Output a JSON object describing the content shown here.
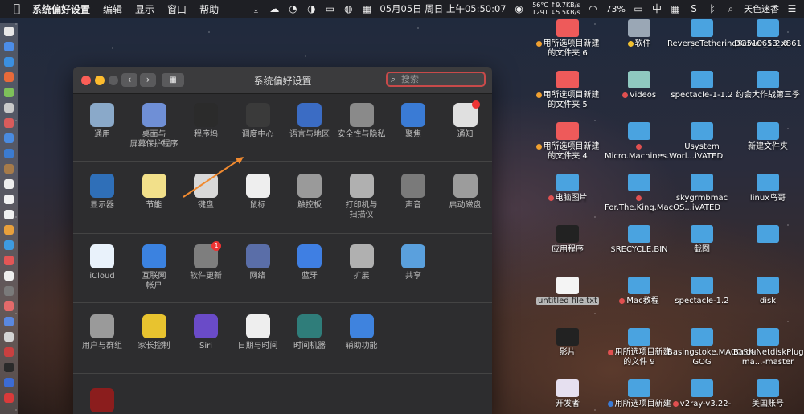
{
  "menubar": {
    "app_name": "系统偏好设置",
    "menus": [
      "编辑",
      "显示",
      "窗口",
      "帮助"
    ],
    "net_up": "56°C ↑9.7KB/s",
    "net_down": "1291 ↓5.5KB/s",
    "clock": "05月05日 周日 上午05:50:07",
    "battery": "73%",
    "input_method": "中",
    "user": "天色迷香"
  },
  "window": {
    "title": "系统偏好设置",
    "search_placeholder": "搜索"
  },
  "panes": {
    "row1": [
      {
        "label": "通用",
        "icon": "general-icon",
        "color": "#8aa9c9"
      },
      {
        "label": "桌面与\n屏幕保护程序",
        "icon": "desktop-icon",
        "color": "#6f8fd6"
      },
      {
        "label": "程序坞",
        "icon": "dock-icon",
        "color": "#2b2b2b"
      },
      {
        "label": "调度中心",
        "icon": "mission-control-icon",
        "color": "#3a3a3a"
      },
      {
        "label": "语言与地区",
        "icon": "language-flag-icon",
        "color": "#3b6cc4"
      },
      {
        "label": "安全性与隐私",
        "icon": "security-house-icon",
        "color": "#8a8a8a"
      },
      {
        "label": "聚焦",
        "icon": "spotlight-icon",
        "color": "#3a7bd5"
      },
      {
        "label": "通知",
        "icon": "notifications-icon",
        "color": "#e0e0e0"
      }
    ],
    "row2": [
      {
        "label": "显示器",
        "icon": "display-icon",
        "color": "#2f6fb8"
      },
      {
        "label": "节能",
        "icon": "energy-bulb-icon",
        "color": "#f2e08a"
      },
      {
        "label": "键盘",
        "icon": "keyboard-icon",
        "color": "#d8d8d8"
      },
      {
        "label": "鼠标",
        "icon": "mouse-icon",
        "color": "#eeeeee"
      },
      {
        "label": "触控板",
        "icon": "trackpad-icon",
        "color": "#9a9a9a"
      },
      {
        "label": "打印机与\n扫描仪",
        "icon": "printer-icon",
        "color": "#b0b0b0"
      },
      {
        "label": "声音",
        "icon": "speaker-icon",
        "color": "#7a7a7a"
      },
      {
        "label": "启动磁盘",
        "icon": "startup-disk-icon",
        "color": "#9c9c9c"
      }
    ],
    "row3": [
      {
        "label": "iCloud",
        "icon": "icloud-icon",
        "color": "#e9f2fb"
      },
      {
        "label": "互联网\n帐户",
        "icon": "internet-accounts-icon",
        "color": "#3b82e0"
      },
      {
        "label": "软件更新",
        "icon": "software-update-icon",
        "color": "#7e7e7e"
      },
      {
        "label": "网络",
        "icon": "network-globe-icon",
        "color": "#5a6ea8"
      },
      {
        "label": "蓝牙",
        "icon": "bluetooth-icon",
        "color": "#3f7fe3"
      },
      {
        "label": "扩展",
        "icon": "extensions-icon",
        "color": "#b0b0b0"
      },
      {
        "label": "共享",
        "icon": "sharing-icon",
        "color": "#5aa0dd"
      }
    ],
    "row4": [
      {
        "label": "用户与群组",
        "icon": "users-groups-icon",
        "color": "#9a9a9a"
      },
      {
        "label": "家长控制",
        "icon": "parental-controls-icon",
        "color": "#e8c32f"
      },
      {
        "label": "Siri",
        "icon": "siri-icon",
        "color": "#6a4bc8"
      },
      {
        "label": "日期与时间",
        "icon": "date-time-icon",
        "color": "#eeeeee"
      },
      {
        "label": "时间机器",
        "icon": "time-machine-icon",
        "color": "#2f7d7a"
      },
      {
        "label": "辅助功能",
        "icon": "accessibility-icon",
        "color": "#3f83de"
      }
    ],
    "row5": [
      {
        "label": "",
        "icon": "flash-player-icon",
        "color": "#8b1d1d"
      }
    ],
    "software_update_badge": "1"
  },
  "desktop_items": [
    {
      "label": "用所选项目新建的文件夹 6",
      "color": "#ee5a5a",
      "tag": "#f0a030"
    },
    {
      "label": "软件",
      "color": "#9aa7b5",
      "tag": "#f0c030"
    },
    {
      "label": "ReverseTetheringServer_1.2.0",
      "color": "#4aa3e0",
      "tag": ""
    },
    {
      "label": "DG510653_x861",
      "color": "#4aa3e0",
      "tag": ""
    },
    {
      "label": "用所选项目新建的文件夹 5",
      "color": "#ee5a5a",
      "tag": "#f0a030"
    },
    {
      "label": "Videos",
      "color": "#8fc9c0",
      "tag": "#e05050"
    },
    {
      "label": "spectacle-1-1.2",
      "color": "#4aa3e0",
      "tag": ""
    },
    {
      "label": "约会大作战第三季",
      "color": "#4aa3e0",
      "tag": ""
    },
    {
      "label": "用所选项目新建的文件夹 4",
      "color": "#ee5a5a",
      "tag": "#f0a030"
    },
    {
      "label": "Micro.Machines.Worl...iVATED",
      "color": "#4aa3e0",
      "tag": "#e05050"
    },
    {
      "label": "Usystem",
      "color": "#4aa3e0",
      "tag": ""
    },
    {
      "label": "新建文件夹",
      "color": "#4aa3e0",
      "tag": ""
    },
    {
      "label": "电脑图片",
      "color": "#4aa3e0",
      "tag": "#e05050"
    },
    {
      "label": "For.The.King.MacOS...iVATED",
      "color": "#4aa3e0",
      "tag": "#e05050"
    },
    {
      "label": "skygrmbmac",
      "color": "#4aa3e0",
      "tag": ""
    },
    {
      "label": "linux鸟哥",
      "color": "#4aa3e0",
      "tag": ""
    },
    {
      "label": "应用程序",
      "color": "#222222",
      "tag": ""
    },
    {
      "label": "$RECYCLE.BIN",
      "color": "#4aa3e0",
      "tag": ""
    },
    {
      "label": "截图",
      "color": "#4aa3e0",
      "tag": ""
    },
    {
      "label": "",
      "color": "#4aa3e0",
      "tag": ""
    },
    {
      "label": "untitled file.txt",
      "color": "#f4f4f4",
      "tag": "",
      "selected": true
    },
    {
      "label": "Mac教程",
      "color": "#4aa3e0",
      "tag": "#e05050"
    },
    {
      "label": "spectacle-1.2",
      "color": "#4aa3e0",
      "tag": ""
    },
    {
      "label": "disk",
      "color": "#4aa3e0",
      "tag": ""
    },
    {
      "label": "影片",
      "color": "#222222",
      "tag": ""
    },
    {
      "label": "用所选项目新建的文件 9",
      "color": "#4aa3e0",
      "tag": "#e05050"
    },
    {
      "label": "Basingstoke.MACOSX-GOG",
      "color": "#4aa3e0",
      "tag": ""
    },
    {
      "label": "BaiduNetdiskPlugin-ma...-master",
      "color": "#4aa3e0",
      "tag": ""
    },
    {
      "label": "开发者",
      "color": "#e6e0f0",
      "tag": ""
    },
    {
      "label": "用所选项目新建",
      "color": "#4aa3e0",
      "tag": "#3a7bd5"
    },
    {
      "label": "v2ray-v3.22-",
      "color": "#4aa3e0",
      "tag": "#e05050"
    },
    {
      "label": "美国账号",
      "color": "#4aa3e0",
      "tag": ""
    }
  ]
}
